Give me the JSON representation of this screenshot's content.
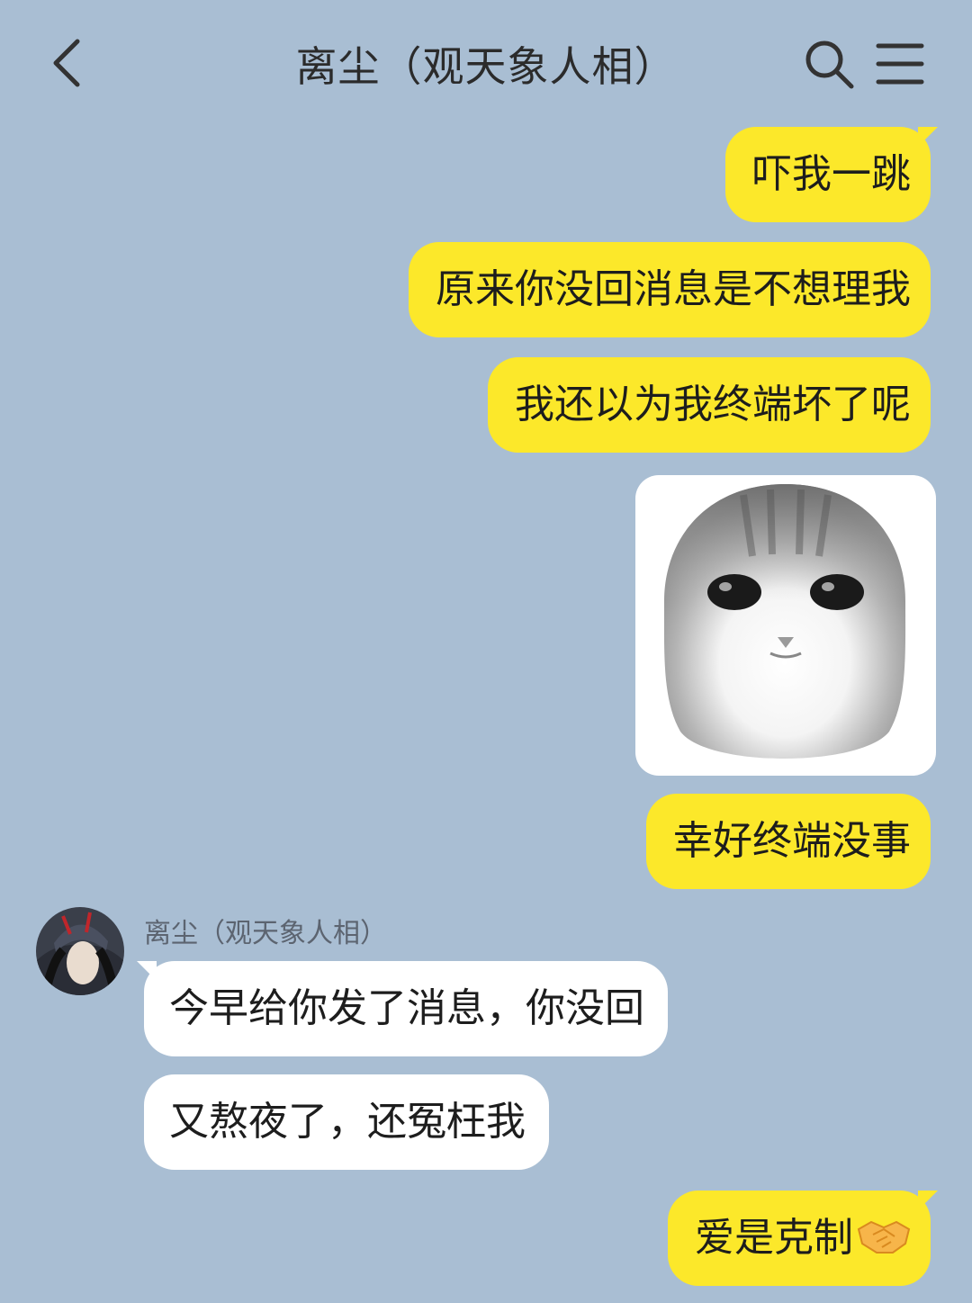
{
  "header": {
    "title": "离尘（观天象人相）",
    "back_icon": "chevron-left-icon",
    "search_icon": "search-icon",
    "menu_icon": "menu-icon"
  },
  "messages": [
    {
      "side": "out",
      "text": "吓我一跳"
    },
    {
      "side": "out",
      "text": "原来你没回消息是不想理我"
    },
    {
      "side": "out",
      "text": "我还以为我终端坏了呢"
    },
    {
      "side": "out",
      "type": "sticker",
      "sticker": "crying-cat-sticker"
    },
    {
      "side": "out",
      "text": "幸好终端没事"
    },
    {
      "side": "in",
      "sender": "离尘（观天象人相）",
      "text": "今早给你发了消息，你没回"
    },
    {
      "side": "in",
      "text": "又熬夜了，还冤枉我"
    },
    {
      "side": "out",
      "text": "爱是克制",
      "emoji": "handshake-emoji"
    }
  ],
  "colors": {
    "background": "#a9bed3",
    "outgoing_bubble": "#fce82a",
    "incoming_bubble": "#ffffff"
  }
}
